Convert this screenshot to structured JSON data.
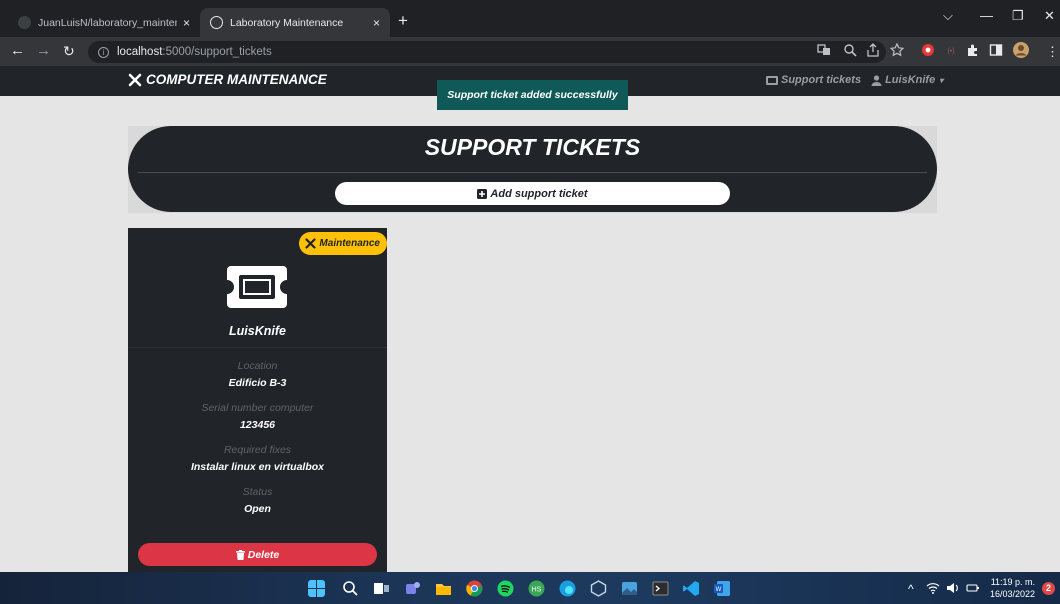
{
  "browser": {
    "tabs": [
      {
        "title": "JuanLuisN/laboratory_maintenan",
        "close": "×"
      },
      {
        "title": "Laboratory Maintenance",
        "close": "×"
      }
    ],
    "new_tab": "+",
    "url_host": "localhost",
    "url_path": ":5000/support_tickets",
    "info_glyph": "i"
  },
  "navbar": {
    "brand": "COMPUTER MAINTENANCE",
    "links": [
      {
        "label": "Support tickets",
        "icon": "ticket-icon"
      },
      {
        "label": "LuisKnife",
        "icon": "user-icon"
      }
    ]
  },
  "toast": {
    "message": "Support ticket added successfully"
  },
  "header": {
    "title": "SUPPORT TICKETS",
    "add_button": "Add support ticket"
  },
  "ticket": {
    "badge": "Maintenance",
    "user": "LuisKnife",
    "fields": [
      {
        "label": "Location",
        "value": "Edificio B-3"
      },
      {
        "label": "Serial number computer",
        "value": "123456"
      },
      {
        "label": "Required fixes",
        "value": "Instalar linux en virtualbox"
      },
      {
        "label": "Status",
        "value": "Open"
      }
    ],
    "delete_button": "Delete"
  },
  "taskbar": {
    "time": "11:19 p. m.",
    "date": "16/03/2022",
    "notifications": "2"
  },
  "colors": {
    "navbar_bg": "#212529",
    "toast_bg": "#0f5a59",
    "badge_bg": "#ffc107",
    "delete_bg": "#dc3545",
    "page_bg": "#e5e5e5"
  }
}
